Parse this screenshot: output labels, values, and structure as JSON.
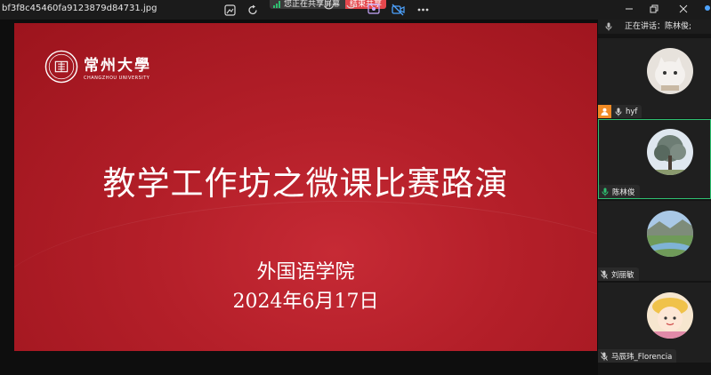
{
  "window": {
    "filename": "bf3f8c45460fa9123879d84731.jpg",
    "share_status": "您正在共享屏幕",
    "stop_share_label": "结束共享"
  },
  "slide": {
    "logo_cn": "常州大學",
    "logo_en": "CHANGZHOU UNIVERSITY",
    "title": "教学工作坊之微课比赛路演",
    "org": "外国语学院",
    "date": "2024年6月17日"
  },
  "panel": {
    "speaking_label": "正在讲话：陈林俊;",
    "participants": [
      {
        "name": "hyf",
        "host": true,
        "active": false
      },
      {
        "name": "陈林俊",
        "host": false,
        "active": true,
        "mic_color": "#2fbf71"
      },
      {
        "name": "刘丽敏",
        "host": false,
        "active": false
      },
      {
        "name": "马辰玮_Florencia",
        "host": false,
        "active": false
      }
    ]
  },
  "colors": {
    "slide_red": "#b41f29",
    "active_border": "#2fbf71",
    "stop_button": "#e5484d",
    "host_badge": "#f08a24"
  },
  "icons": [
    "image-icon",
    "redo-icon",
    "signal-bars-icon",
    "monitor-icon",
    "people-icon",
    "no-video-icon",
    "more-icon",
    "minimize-icon",
    "restore-icon",
    "close-icon",
    "mic-icon",
    "host-icon"
  ]
}
